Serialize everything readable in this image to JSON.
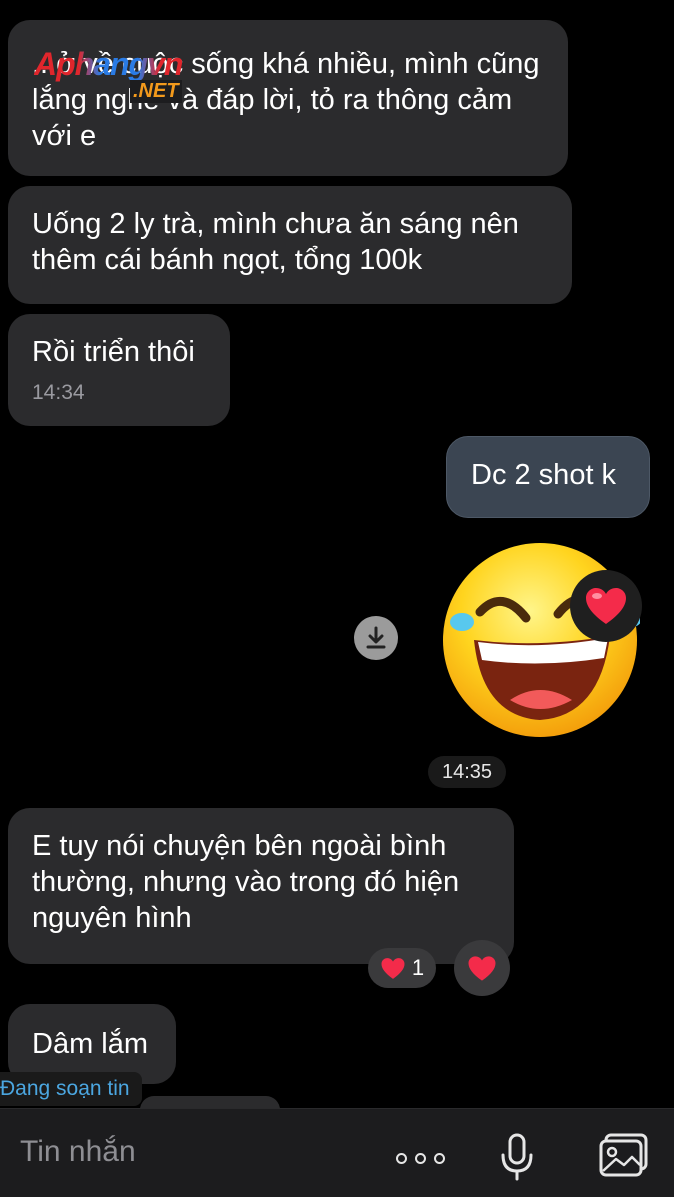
{
  "watermark": {
    "brand": "Aphangvn",
    "suffix": ".NET"
  },
  "messages": [
    {
      "id": "m1",
      "text": "...ở về cuộc sống khá nhiều, mình cũng lắng nghe và đáp lời, tỏ ra thông cảm với e"
    },
    {
      "id": "m2",
      "text": "Uống 2 ly trà, mình chưa ăn sáng nên thêm cái bánh ngọt, tổng 100k"
    },
    {
      "id": "m3",
      "text": "Rồi triển thôi",
      "time": "14:34"
    },
    {
      "id": "m4",
      "text": "Dc 2 shot k"
    },
    {
      "id": "m5",
      "sticker": "laughing-tears-emoji",
      "time": "14:35",
      "reaction": "heart"
    },
    {
      "id": "m6",
      "text": "E tuy nói chuyện bên ngoài bình thường, nhưng vào trong đó hiện nguyên hình",
      "reaction_count": "1"
    },
    {
      "id": "m7",
      "text": "Dâm lắm"
    }
  ],
  "typing_indicator": "Đang soạn tin",
  "composer": {
    "placeholder": "Tin nhắn"
  },
  "icons": [
    "download-icon",
    "heart-icon",
    "more-dots-icon",
    "microphone-icon",
    "image-icon"
  ],
  "colors": {
    "background": "#000000",
    "incoming_bubble": "#2b2b2d",
    "outgoing_bubble": "#3b4552",
    "typing_text": "#4ba6e0"
  }
}
